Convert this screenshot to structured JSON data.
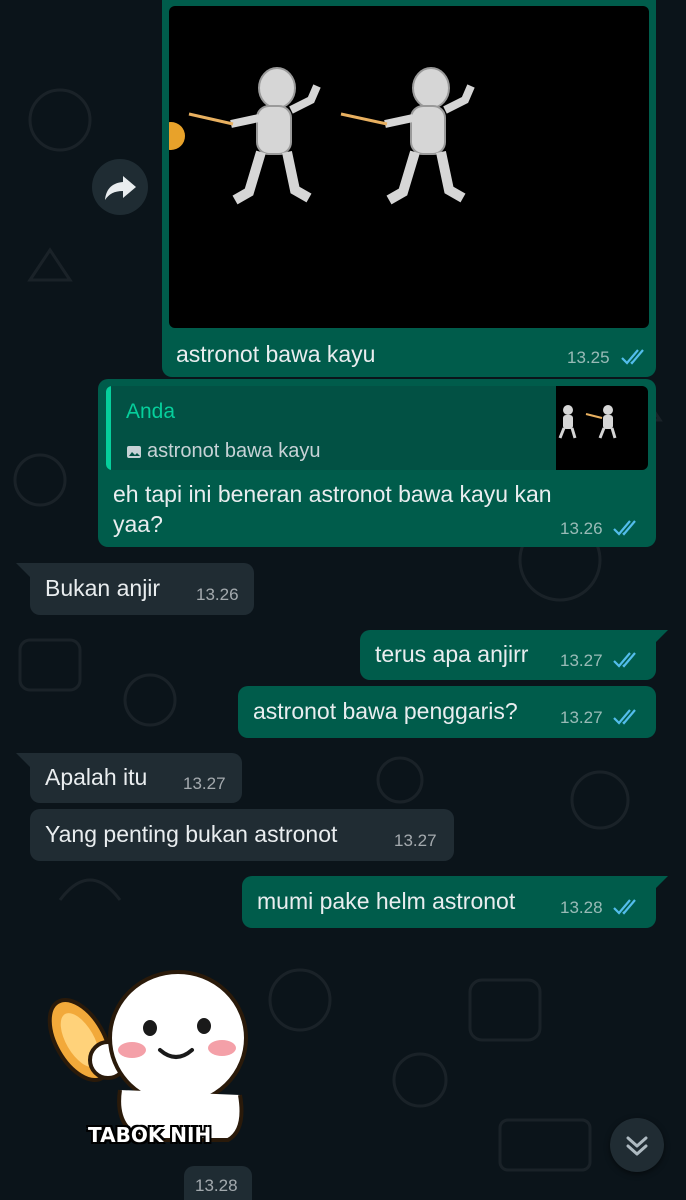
{
  "messages": {
    "m1": {
      "caption": "astronot bawa kayu",
      "time": "13.25"
    },
    "m2": {
      "quote_author": "Anda",
      "quote_text": "astronot bawa kayu",
      "line1": "eh tapi ini beneran astronot bawa kayu kan",
      "line2": "yaa?",
      "time": "13.26"
    },
    "m3": {
      "text": "Bukan anjir",
      "time": "13.26"
    },
    "m4": {
      "text": "terus apa anjirr",
      "time": "13.27"
    },
    "m5": {
      "text": "astronot bawa penggaris?",
      "time": "13.27"
    },
    "m6": {
      "text": "Apalah itu",
      "time": "13.27"
    },
    "m7": {
      "text": "Yang penting bukan astronot",
      "time": "13.27"
    },
    "m8": {
      "text": "mumi pake helm astronot",
      "time": "13.28"
    },
    "m9": {
      "sticker_text": "TABOK NIH",
      "time": "13.28"
    }
  },
  "colors": {
    "outgoing": "#005c4b",
    "incoming": "#202c33",
    "read_ticks": "#53bdeb",
    "quote_author": "#25d366",
    "background": "#0b141a"
  },
  "icons": {
    "forward": "forward-arrow-icon",
    "scroll": "chevron-double-down-icon",
    "image": "image-icon"
  }
}
